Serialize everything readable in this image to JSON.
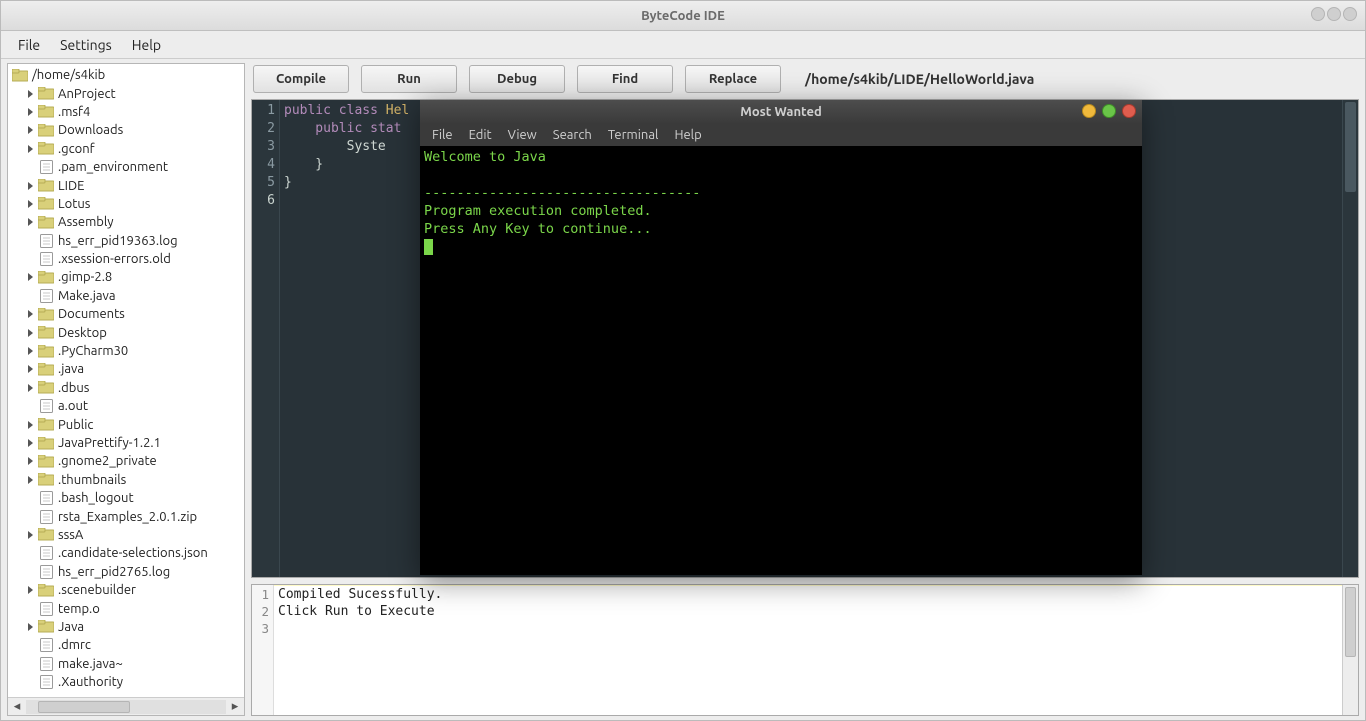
{
  "window": {
    "title": "ByteCode IDE"
  },
  "menubar": [
    "File",
    "Settings",
    "Help"
  ],
  "tree_root": "/home/s4kib",
  "tree": [
    {
      "type": "folder",
      "label": "AnProject",
      "expandable": true
    },
    {
      "type": "folder",
      "label": ".msf4",
      "expandable": true
    },
    {
      "type": "folder",
      "label": "Downloads",
      "expandable": true
    },
    {
      "type": "folder",
      "label": ".gconf",
      "expandable": true
    },
    {
      "type": "file",
      "label": ".pam_environment"
    },
    {
      "type": "folder",
      "label": "LIDE",
      "expandable": true
    },
    {
      "type": "folder",
      "label": "Lotus",
      "expandable": true
    },
    {
      "type": "folder",
      "label": "Assembly",
      "expandable": true
    },
    {
      "type": "file",
      "label": "hs_err_pid19363.log"
    },
    {
      "type": "file",
      "label": ".xsession-errors.old"
    },
    {
      "type": "folder",
      "label": ".gimp-2.8",
      "expandable": true
    },
    {
      "type": "file",
      "label": "Make.java"
    },
    {
      "type": "folder",
      "label": "Documents",
      "expandable": true
    },
    {
      "type": "folder",
      "label": "Desktop",
      "expandable": true
    },
    {
      "type": "folder",
      "label": ".PyCharm30",
      "expandable": true
    },
    {
      "type": "folder",
      "label": ".java",
      "expandable": true
    },
    {
      "type": "folder",
      "label": ".dbus",
      "expandable": true
    },
    {
      "type": "file",
      "label": "a.out"
    },
    {
      "type": "folder",
      "label": "Public",
      "expandable": true
    },
    {
      "type": "folder",
      "label": "JavaPrettify-1.2.1",
      "expandable": true
    },
    {
      "type": "folder",
      "label": ".gnome2_private",
      "expandable": true
    },
    {
      "type": "folder",
      "label": ".thumbnails",
      "expandable": true
    },
    {
      "type": "file",
      "label": ".bash_logout"
    },
    {
      "type": "file",
      "label": "rsta_Examples_2.0.1.zip"
    },
    {
      "type": "folder",
      "label": "sssA",
      "expandable": true
    },
    {
      "type": "file",
      "label": ".candidate-selections.json"
    },
    {
      "type": "file",
      "label": "hs_err_pid2765.log"
    },
    {
      "type": "folder",
      "label": ".scenebuilder",
      "expandable": true
    },
    {
      "type": "file",
      "label": "temp.o"
    },
    {
      "type": "folder",
      "label": "Java",
      "expandable": true
    },
    {
      "type": "file",
      "label": ".dmrc"
    },
    {
      "type": "file",
      "label": "make.java~"
    },
    {
      "type": "file",
      "label": ".Xauthority"
    }
  ],
  "toolbar": {
    "compile": "Compile",
    "run": "Run",
    "debug": "Debug",
    "find": "Find",
    "replace": "Replace",
    "filepath": "/home/s4kib/LIDE/HelloWorld.java"
  },
  "editor": {
    "lines": [
      1,
      2,
      3,
      4,
      5,
      6
    ],
    "current_line": 6,
    "code": {
      "l1a": "public",
      "l1b": "class",
      "l1c": "Hel",
      "l2a": "    public",
      "l2b": "stat",
      "l3": "        Syste",
      "l4": "    }",
      "l5": "}",
      "l6": ""
    }
  },
  "terminal": {
    "title": "Most Wanted",
    "menubar": [
      "File",
      "Edit",
      "View",
      "Search",
      "Terminal",
      "Help"
    ],
    "lines": [
      "Welcome to Java",
      "",
      "----------------------------------",
      "Program execution completed.",
      "Press Any Key to continue..."
    ]
  },
  "console": {
    "lines": [
      1,
      2,
      3
    ],
    "text": {
      "l1": "",
      "l2": "Compiled Sucessfully.",
      "l3": "Click Run to Execute"
    }
  }
}
